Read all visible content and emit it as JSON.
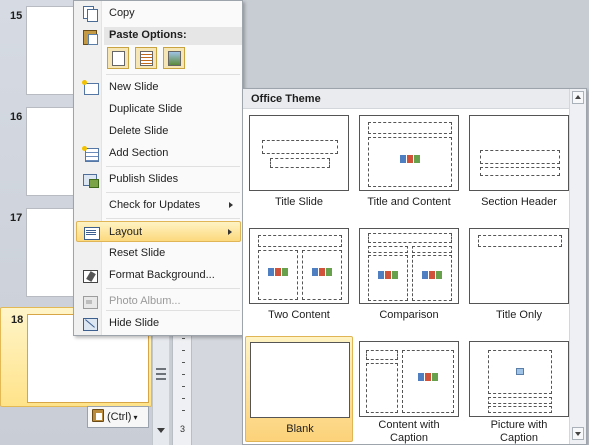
{
  "thumbnails": [
    {
      "number": "15",
      "selected": false
    },
    {
      "number": "16",
      "selected": false
    },
    {
      "number": "17",
      "selected": false
    },
    {
      "number": "18",
      "selected": true
    }
  ],
  "paste_tag": {
    "label": "(Ctrl)"
  },
  "ruler": {
    "number": "3"
  },
  "context_menu": {
    "copy": "Copy",
    "paste_options_header": "Paste Options:",
    "new_slide": "New Slide",
    "duplicate_slide": "Duplicate Slide",
    "delete_slide": "Delete Slide",
    "add_section": "Add Section",
    "publish_slides": "Publish Slides",
    "check_for_updates": "Check for Updates",
    "layout": "Layout",
    "reset_slide": "Reset Slide",
    "format_background": "Format Background...",
    "photo_album": "Photo Album...",
    "hide_slide": "Hide Slide"
  },
  "layout_gallery": {
    "header": "Office Theme",
    "layouts": [
      {
        "name": "Title Slide"
      },
      {
        "name": "Title and Content"
      },
      {
        "name": "Section Header"
      },
      {
        "name": "Two Content"
      },
      {
        "name": "Comparison"
      },
      {
        "name": "Title Only"
      },
      {
        "name": "Blank"
      },
      {
        "name_line1": "Content with",
        "name_line2": "Caption"
      },
      {
        "name_line1": "Picture with",
        "name_line2": "Caption"
      }
    ]
  },
  "colors": {
    "highlight": "#fcd97d",
    "highlight_border": "#e0b556",
    "menu_bg": "#fafafa"
  }
}
